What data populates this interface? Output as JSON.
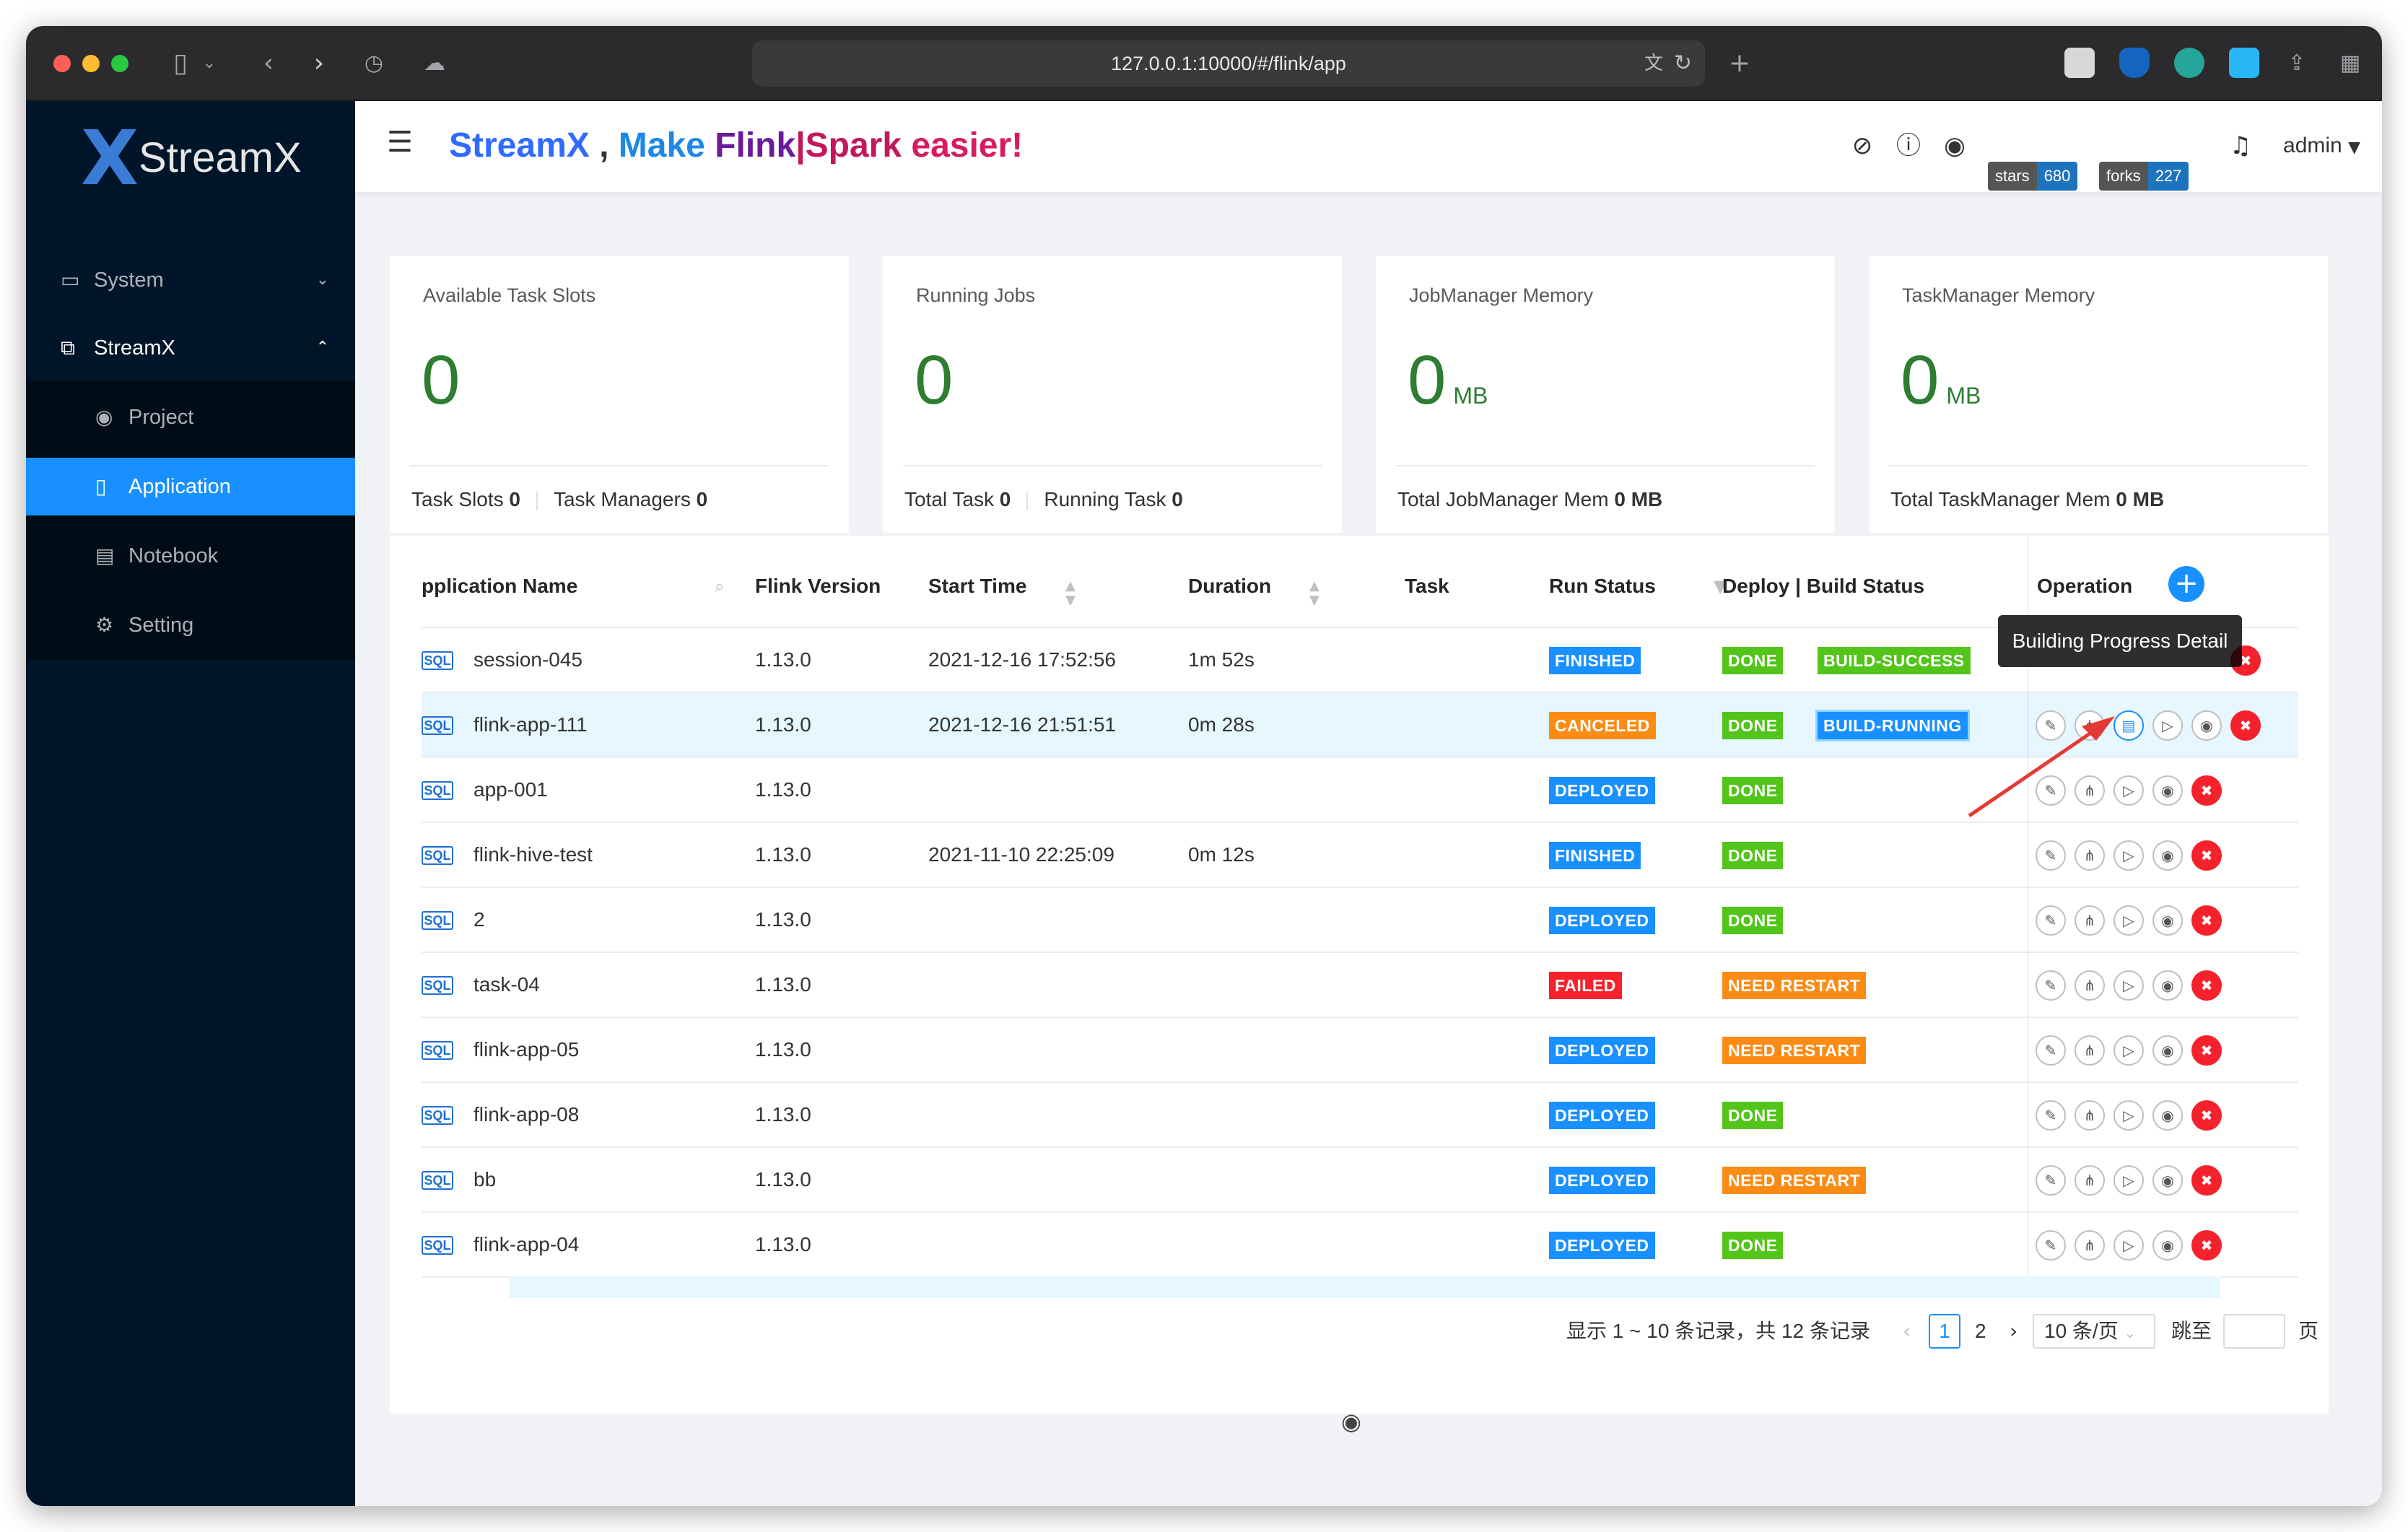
{
  "browser": {
    "url": "127.0.0.1:10000/#/flink/app"
  },
  "sidebar": {
    "brand": "StreamX",
    "items": [
      {
        "label": "System",
        "icon": "monitor-icon",
        "arrow": "chevron-down-icon"
      },
      {
        "label": "StreamX",
        "icon": "cluster-icon",
        "arrow": "chevron-up-icon"
      },
      {
        "label": "Project",
        "icon": "github-icon"
      },
      {
        "label": "Application",
        "icon": "mobile-icon"
      },
      {
        "label": "Notebook",
        "icon": "book-icon"
      },
      {
        "label": "Setting",
        "icon": "gear-icon"
      }
    ]
  },
  "header": {
    "slogan": {
      "p1": "StreamX",
      "p2": " , ",
      "p3": "Make ",
      "p4": "Flink",
      "p5": "|Spark",
      "p6": " easier!"
    },
    "stars_label": "stars",
    "stars_value": "680",
    "forks_label": "forks",
    "forks_value": "227",
    "user": "admin"
  },
  "stats": [
    {
      "title": "Available Task Slots",
      "value": "0",
      "unit": "",
      "foot": [
        {
          "label": "Task Slots",
          "value": "0"
        },
        {
          "label": "Task Managers",
          "value": "0"
        }
      ]
    },
    {
      "title": "Running Jobs",
      "value": "0",
      "unit": "",
      "foot": [
        {
          "label": "Total Task",
          "value": "0"
        },
        {
          "label": "Running Task",
          "value": "0"
        }
      ]
    },
    {
      "title": "JobManager Memory",
      "value": "0",
      "unit": "MB",
      "foot": [
        {
          "label": "Total JobManager Mem",
          "value": "0 MB"
        }
      ]
    },
    {
      "title": "TaskManager Memory",
      "value": "0",
      "unit": "MB",
      "foot": [
        {
          "label": "Total TaskManager Mem",
          "value": "0 MB"
        }
      ]
    }
  ],
  "table": {
    "columns": {
      "name": "pplication Name",
      "flink_version": "Flink Version",
      "start_time": "Start Time",
      "duration": "Duration",
      "task": "Task",
      "run_status": "Run Status",
      "deploy_status": "Deploy | Build Status",
      "operation": "Operation"
    },
    "sql_icon": "SQL",
    "rows": [
      {
        "name": "session-045",
        "version": "1.13.0",
        "start": "2021-12-16 17:52:56",
        "duration": "1m 52s",
        "run": "FINISHED",
        "deploy": "DONE",
        "build": "BUILD-SUCCESS"
      },
      {
        "name": "flink-app-111",
        "version": "1.13.0",
        "start": "2021-12-16 21:51:51",
        "duration": "0m 28s",
        "run": "CANCELED",
        "deploy": "DONE",
        "build": "BUILD-RUNNING"
      },
      {
        "name": "app-001",
        "version": "1.13.0",
        "start": "",
        "duration": "",
        "run": "DEPLOYED",
        "deploy": "DONE",
        "build": ""
      },
      {
        "name": "flink-hive-test",
        "version": "1.13.0",
        "start": "2021-11-10 22:25:09",
        "duration": "0m 12s",
        "run": "FINISHED",
        "deploy": "DONE",
        "build": ""
      },
      {
        "name": "2",
        "version": "1.13.0",
        "start": "",
        "duration": "",
        "run": "DEPLOYED",
        "deploy": "DONE",
        "build": ""
      },
      {
        "name": "task-04",
        "version": "1.13.0",
        "start": "",
        "duration": "",
        "run": "FAILED",
        "deploy": "NEED RESTART",
        "build": ""
      },
      {
        "name": "flink-app-05",
        "version": "1.13.0",
        "start": "",
        "duration": "",
        "run": "DEPLOYED",
        "deploy": "NEED RESTART",
        "build": ""
      },
      {
        "name": "flink-app-08",
        "version": "1.13.0",
        "start": "",
        "duration": "",
        "run": "DEPLOYED",
        "deploy": "DONE",
        "build": ""
      },
      {
        "name": "bb",
        "version": "1.13.0",
        "start": "",
        "duration": "",
        "run": "DEPLOYED",
        "deploy": "NEED RESTART",
        "build": ""
      },
      {
        "name": "flink-app-04",
        "version": "1.13.0",
        "start": "",
        "duration": "",
        "run": "DEPLOYED",
        "deploy": "DONE",
        "build": ""
      }
    ],
    "tooltip": "Building Progress Detail"
  },
  "pagination": {
    "summary": "显示 1 ~ 10 条记录，共 12 条记录",
    "pages": [
      "1",
      "2"
    ],
    "current": "1",
    "page_size": "10 条/页",
    "jump_label": "跳至",
    "page_suffix": "页"
  },
  "colors": {
    "FINISHED": "#1890ff",
    "CANCELED": "#fa8c16",
    "DEPLOYED": "#1890ff",
    "FAILED": "#f5222d",
    "DONE": "#52c41a",
    "NEED RESTART": "#fa8c16",
    "BUILD-SUCCESS": "#52c41a",
    "BUILD-RUNNING": "#1890ff"
  }
}
